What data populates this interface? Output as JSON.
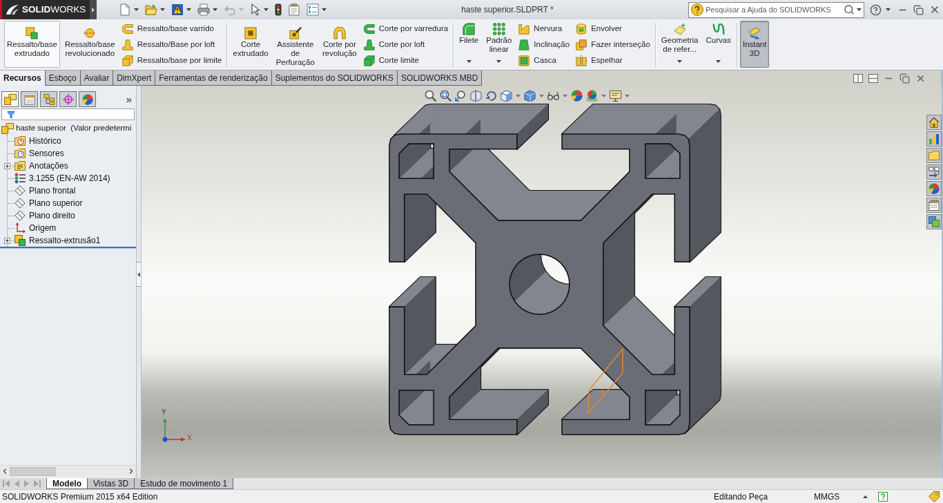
{
  "title_bar": {
    "logo": "**SOLID**WORKS",
    "title": "haste superior.SLDPRT *",
    "search": {
      "placeholder": "Pesquisar a Ajuda do SOLIDWORKS"
    }
  },
  "ribbon": {
    "groups": [
      {
        "items": [
          {
            "kind": "large",
            "label": "Ressalto/base\nextrudado",
            "hovered": true,
            "pressed": false,
            "dropdown": false
          },
          {
            "kind": "large",
            "label": "Ressalto/base\nrevolucionado",
            "hovered": false,
            "pressed": false,
            "dropdown": false
          },
          {
            "kind": "stack",
            "buttons": [
              {
                "label": "Ressalto/base varrido"
              },
              {
                "label": "Ressalto/Base por loft"
              },
              {
                "label": "Ressalto/base por limite"
              }
            ]
          }
        ]
      },
      {
        "items": [
          {
            "kind": "large",
            "label": "Corte\nextrudado",
            "hovered": false,
            "pressed": false,
            "dropdown": false
          },
          {
            "kind": "large",
            "label": "Assistente\nde\nPerfuração",
            "hovered": false,
            "pressed": false,
            "dropdown": false
          },
          {
            "kind": "large",
            "label": "Corte por\nrevolução",
            "hovered": false,
            "pressed": false,
            "dropdown": false
          },
          {
            "kind": "stack",
            "buttons": [
              {
                "label": "Corte por varredura"
              },
              {
                "label": "Corte por loft"
              },
              {
                "label": "Corte limite"
              }
            ]
          }
        ]
      },
      {
        "items": [
          {
            "kind": "large",
            "label": "Filete",
            "hovered": false,
            "pressed": false,
            "dropdown": true
          },
          {
            "kind": "large",
            "label": "Padrão\nlinear",
            "hovered": false,
            "pressed": false,
            "dropdown": true
          },
          {
            "kind": "stack",
            "buttons": [
              {
                "label": "Nervura"
              },
              {
                "label": "Inclinação"
              },
              {
                "label": "Casca"
              }
            ]
          },
          {
            "kind": "stack",
            "buttons": [
              {
                "label": "Envolver"
              },
              {
                "label": "Fazer interseção"
              },
              {
                "label": "Espelhar"
              }
            ]
          }
        ]
      },
      {
        "items": [
          {
            "kind": "large",
            "label": "Geometria\nde refer...",
            "hovered": false,
            "pressed": false,
            "dropdown": true
          },
          {
            "kind": "large",
            "label": "Curvas",
            "hovered": false,
            "pressed": false,
            "dropdown": true
          }
        ]
      },
      {
        "items": [
          {
            "kind": "large",
            "label": "Instant\n3D",
            "hovered": false,
            "pressed": true,
            "dropdown": false
          }
        ]
      }
    ]
  },
  "command_tabs": [
    {
      "label": "Recursos",
      "selected": true
    },
    {
      "label": "Esboço",
      "selected": false
    },
    {
      "label": "Avaliar",
      "selected": false
    },
    {
      "label": "DimXpert",
      "selected": false
    },
    {
      "label": "Ferramentas de renderização",
      "selected": false
    },
    {
      "label": "Suplementos do SOLIDWORKS",
      "selected": false
    },
    {
      "label": "SOLIDWORKS MBD",
      "selected": false
    }
  ],
  "feature_manager": {
    "panel_tabs": [
      {
        "selected": true
      },
      {
        "selected": false
      },
      {
        "selected": false
      },
      {
        "selected": false
      },
      {
        "selected": false
      }
    ],
    "more": "»",
    "tree": {
      "label": "haste superior  (Valor predetermi",
      "children": [
        {
          "kind": "history",
          "label": "Histórico",
          "expandable": false
        },
        {
          "kind": "sensors",
          "label": "Sensores",
          "expandable": false
        },
        {
          "kind": "annotations",
          "label": "Anotações",
          "expandable": true
        },
        {
          "kind": "material",
          "label": "3.1255 (EN-AW 2014)",
          "expandable": false
        },
        {
          "kind": "plane",
          "label": "Plano frontal",
          "expandable": false
        },
        {
          "kind": "plane",
          "label": "Plano superior",
          "expandable": false
        },
        {
          "kind": "plane",
          "label": "Plano direito",
          "expandable": false
        },
        {
          "kind": "origin",
          "label": "Origem",
          "expandable": false
        },
        {
          "kind": "feature",
          "label": "Ressalto-extrusão1",
          "expandable": true
        }
      ]
    }
  },
  "viewport": {
    "triad": {
      "y": "Y",
      "x": "X"
    }
  },
  "bottom_tabs": [
    {
      "label": "Modelo",
      "selected": true
    },
    {
      "label": "Vistas 3D",
      "selected": false
    },
    {
      "label": "Estudo de movimento 1",
      "selected": false
    }
  ],
  "status_bar": {
    "edition": "SOLIDWORKS Premium 2015 x64 Edition",
    "mode": "Editando Peça",
    "units": "MMGS"
  }
}
